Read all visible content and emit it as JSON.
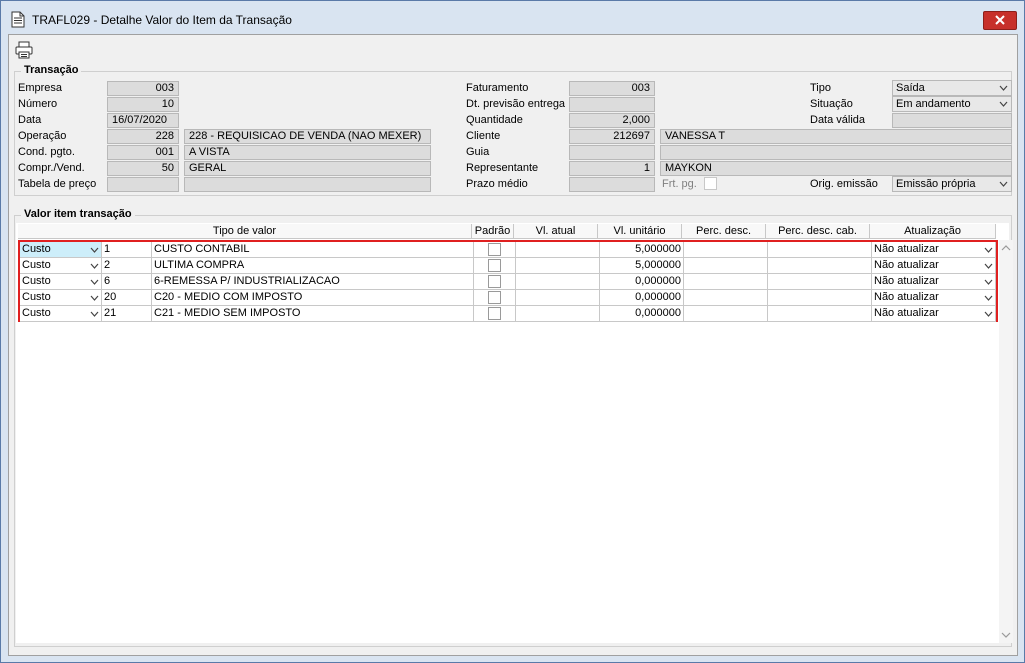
{
  "window": {
    "title": "TRAFL029 - Detalhe Valor do Item da Transação"
  },
  "transacao": {
    "group_label": "Transação",
    "empresa": {
      "label": "Empresa",
      "value": "003"
    },
    "numero": {
      "label": "Número",
      "value": "10"
    },
    "data": {
      "label": "Data",
      "value": "16/07/2020"
    },
    "operacao": {
      "label": "Operação",
      "code": "228",
      "desc": "228 - REQUISICAO DE VENDA (NAO MEXER)"
    },
    "cond_pgto": {
      "label": "Cond. pgto.",
      "code": "001",
      "desc": "A VISTA"
    },
    "compr_vend": {
      "label": "Compr./Vend.",
      "code": "50",
      "desc": "GERAL"
    },
    "tabela_preco": {
      "label": "Tabela de preço",
      "code": "",
      "desc": ""
    },
    "faturamento": {
      "label": "Faturamento",
      "value": "003"
    },
    "dt_prev_entrega": {
      "label": "Dt. previsão entrega",
      "value": ""
    },
    "quantidade": {
      "label": "Quantidade",
      "value": "2,000"
    },
    "cliente": {
      "label": "Cliente",
      "code": "212697",
      "desc": "VANESSA T"
    },
    "guia": {
      "label": "Guia",
      "code": "",
      "desc": ""
    },
    "representante": {
      "label": "Representante",
      "code": "1",
      "desc": "MAYKON"
    },
    "prazo_medio": {
      "label": "Prazo médio",
      "value": ""
    },
    "frt_pg": {
      "label": "Frt. pg."
    },
    "tipo": {
      "label": "Tipo",
      "value": "Saída"
    },
    "situacao": {
      "label": "Situação",
      "value": "Em andamento"
    },
    "data_valida": {
      "label": "Data válida",
      "value": ""
    },
    "orig_emissao": {
      "label": "Orig. emissão",
      "value": "Emissão própria"
    }
  },
  "valor_item": {
    "group_label": "Valor item transação",
    "columns": [
      "Tipo de valor",
      "Padrão",
      "Vl. atual",
      "Vl. unitário",
      "Perc. desc.",
      "Perc. desc. cab.",
      "Atualização"
    ],
    "rows": [
      {
        "tipo": "Custo",
        "code": "1",
        "desc": "CUSTO CONTABIL",
        "vl_atual": "",
        "vl_unitario": "5,000000",
        "perc_desc": "",
        "perc_desc_cab": "",
        "atualizacao": "Não atualizar"
      },
      {
        "tipo": "Custo",
        "code": "2",
        "desc": "ULTIMA COMPRA",
        "vl_atual": "",
        "vl_unitario": "5,000000",
        "perc_desc": "",
        "perc_desc_cab": "",
        "atualizacao": "Não atualizar"
      },
      {
        "tipo": "Custo",
        "code": "6",
        "desc": "6-REMESSA P/ INDUSTRIALIZACAO",
        "vl_atual": "",
        "vl_unitario": "0,000000",
        "perc_desc": "",
        "perc_desc_cab": "",
        "atualizacao": "Não atualizar"
      },
      {
        "tipo": "Custo",
        "code": "20",
        "desc": "C20 - MEDIO COM IMPOSTO",
        "vl_atual": "",
        "vl_unitario": "0,000000",
        "perc_desc": "",
        "perc_desc_cab": "",
        "atualizacao": "Não atualizar"
      },
      {
        "tipo": "Custo",
        "code": "21",
        "desc": "C21 - MEDIO SEM IMPOSTO",
        "vl_atual": "",
        "vl_unitario": "0,000000",
        "perc_desc": "",
        "perc_desc_cab": "",
        "atualizacao": "Não atualizar"
      }
    ]
  },
  "icons": {
    "document": "document-icon",
    "close": "close-icon",
    "print": "print-icon",
    "chevron": "chevron-down-icon"
  }
}
